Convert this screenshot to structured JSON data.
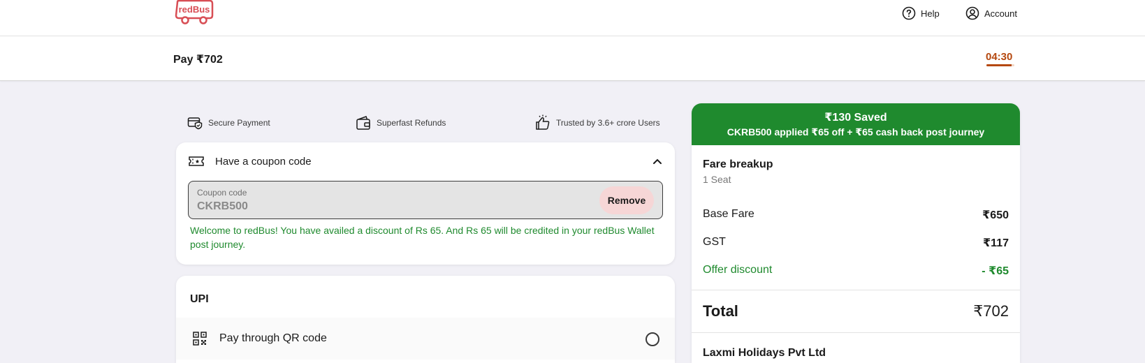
{
  "brand": {
    "logo_text": "redBus",
    "color": "#d84e55"
  },
  "nav": {
    "help_label": "Help",
    "account_label": "Account"
  },
  "pay_header": {
    "title": "Pay ₹702",
    "timer": "04:30",
    "timer_progress": 0.9
  },
  "trust_badges": [
    {
      "icon": "secure-payment-icon",
      "label": "Secure Payment"
    },
    {
      "icon": "wallet-icon",
      "label": "Superfast Refunds"
    },
    {
      "icon": "thumbs-up-icon",
      "label": "Trusted by 3.6+ crore Users"
    }
  ],
  "coupon": {
    "heading": "Have a coupon code",
    "field_label": "Coupon code",
    "value": "CKRB500",
    "remove_label": "Remove",
    "message": "Welcome to redBus! You have availed a discount of Rs 65. And Rs 65 will be credited in your redBus Wallet post journey."
  },
  "upi": {
    "title": "UPI",
    "option_label": "Pay through QR code"
  },
  "fare": {
    "saved_title": "₹130 Saved",
    "saved_subtitle": "CKRB500 applied ₹65 off + ₹65 cash back post journey",
    "title": "Fare breakup",
    "seats": "1 Seat",
    "rows": [
      {
        "label": "Base Fare",
        "amount": "₹650"
      },
      {
        "label": "GST",
        "amount": "₹117"
      },
      {
        "label": "Offer discount",
        "amount": "- ₹65"
      }
    ],
    "total_label": "Total",
    "total_amount": "₹702",
    "operator": "Laxmi Holidays Pvt Ltd"
  },
  "colors": {
    "accent_green": "#1f8a2e",
    "timer_orange": "#b5480f",
    "remove_bg": "#f6d6d6"
  }
}
